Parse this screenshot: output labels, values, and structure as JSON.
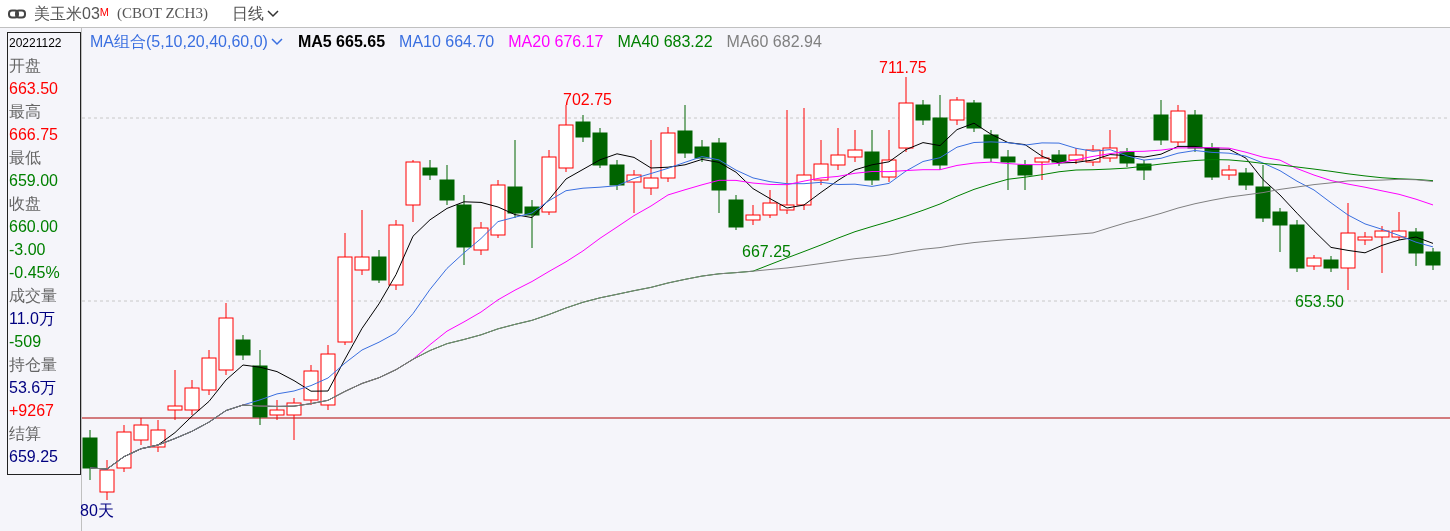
{
  "header": {
    "title": "美玉米03",
    "badge": "M",
    "code": "(CBOT ZCH3)",
    "period": "日线"
  },
  "info_panel": {
    "date": "20221122",
    "rows": [
      {
        "text": "开盘",
        "color": "#666666"
      },
      {
        "text": "663.50",
        "color": "#ff0000"
      },
      {
        "text": "最高",
        "color": "#666666"
      },
      {
        "text": "666.75",
        "color": "#ff0000"
      },
      {
        "text": "最低",
        "color": "#666666"
      },
      {
        "text": "659.00",
        "color": "#008000"
      },
      {
        "text": "收盘",
        "color": "#666666"
      },
      {
        "text": "660.00",
        "color": "#008000"
      },
      {
        "text": "-3.00",
        "color": "#008000"
      },
      {
        "text": "-0.45%",
        "color": "#008000"
      },
      {
        "text": "成交量",
        "color": "#666666"
      },
      {
        "text": "11.0万",
        "color": "#000080"
      },
      {
        "text": "-509",
        "color": "#008000"
      },
      {
        "text": "持仓量",
        "color": "#666666"
      },
      {
        "text": "53.6万",
        "color": "#000080"
      },
      {
        "text": "+9267",
        "color": "#ff0000"
      },
      {
        "text": "结算",
        "color": "#666666"
      },
      {
        "text": "659.25",
        "color": "#000080"
      }
    ]
  },
  "ma_legend": {
    "combo": "MA组合(5,10,20,40,60,0)",
    "items": [
      {
        "label": "MA5 665.65",
        "color": "#000000"
      },
      {
        "label": "MA10 664.70",
        "color": "#3a6fe0"
      },
      {
        "label": "MA20 676.17",
        "color": "#ff00ff"
      },
      {
        "label": "MA40 683.22",
        "color": "#008000"
      },
      {
        "label": "MA60 682.94",
        "color": "#808080"
      }
    ]
  },
  "price_labels": [
    {
      "text": "702.75",
      "kind": "high"
    },
    {
      "text": "711.75",
      "kind": "high"
    },
    {
      "text": "667.25",
      "kind": "low"
    },
    {
      "text": "653.50",
      "kind": "low"
    }
  ],
  "range_label": "80天"
}
